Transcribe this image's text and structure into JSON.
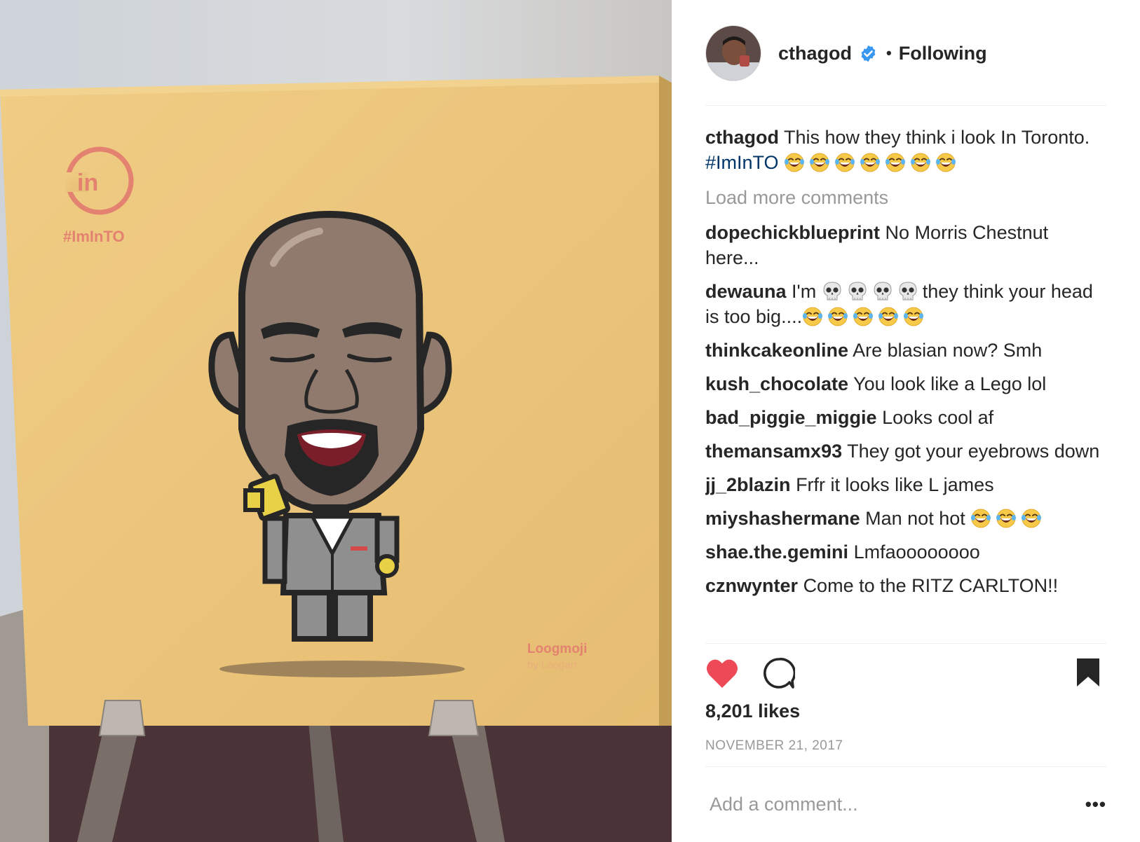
{
  "post": {
    "username": "cthagod",
    "follow_status": "Following",
    "separator_dot": "•",
    "caption_text": "This how they think i look In Toronto.",
    "caption_hashtag": "#ImInTO",
    "load_more": "Load more comments",
    "likes": "8,201 likes",
    "date": "NOVEMBER 21, 2017",
    "add_comment_placeholder": "Add a comment...",
    "more_options": "•••"
  },
  "photo": {
    "canvas_badge": "in",
    "canvas_hashtag": "#ImInTO",
    "brand_name": "Loogmoji",
    "brand_sub": "by Loogart"
  },
  "comments": [
    {
      "user": "dopechickblueprint",
      "text": "No Morris Chestnut here..."
    },
    {
      "user": "dewauna",
      "text_before": "I'm",
      "text_after": "they think your head is too big....",
      "skulls": 4,
      "laughs": 5
    },
    {
      "user": "thinkcakeonline",
      "text": "Are blasian now? Smh"
    },
    {
      "user": "kush_chocolate",
      "text": "You look like a Lego lol"
    },
    {
      "user": "bad_piggie_miggie",
      "text": "Looks cool af"
    },
    {
      "user": "themansamx93",
      "text": "They got your eyebrows down"
    },
    {
      "user": "jj_2blazin",
      "text": "Frfr it looks like L james"
    },
    {
      "user": "miyshashermane",
      "text": "Man not hot",
      "laughs": 3
    },
    {
      "user": "shae.the.gemini",
      "text": "Lmfaoooooooo"
    },
    {
      "user": "cznwynter",
      "text": "Come to the RITZ CARLTON!!"
    }
  ],
  "colors": {
    "heart": "#ed4956",
    "verified": "#3897f0",
    "hashtag": "#003569",
    "muted": "#999999",
    "canvas": "#e9c27a"
  },
  "icons": [
    "verified-icon",
    "heart-icon",
    "comment-icon",
    "bookmark-icon",
    "laughing-emoji-icon",
    "skull-emoji-icon"
  ]
}
